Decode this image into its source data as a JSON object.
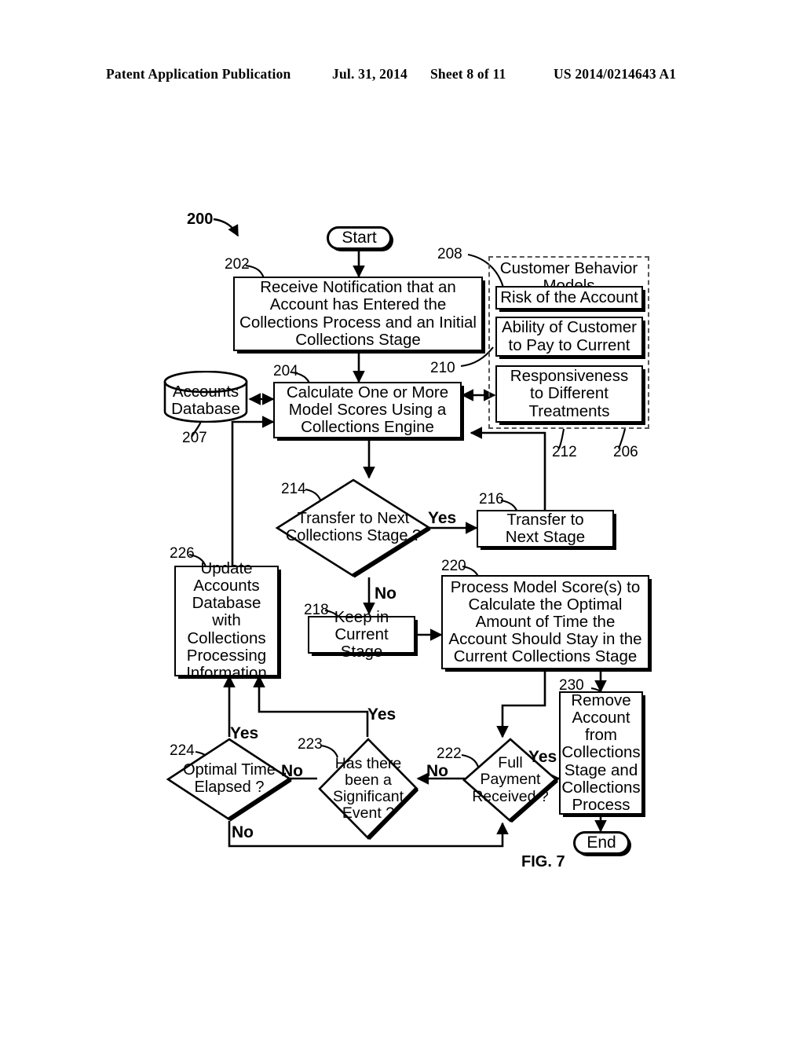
{
  "header": {
    "publication": "Patent Application Publication",
    "date": "Jul. 31, 2014",
    "sheet": "Sheet 8 of 11",
    "doc_number": "US 2014/0214643 A1"
  },
  "figure": {
    "caption": "FIG. 7",
    "diagram_number": "200"
  },
  "nodes": {
    "start": {
      "ref": "",
      "label": "Start"
    },
    "n202": {
      "ref": "202",
      "label": "Receive Notification that an Account has Entered the Collections Process and an Initial Collections Stage"
    },
    "n207": {
      "ref": "207",
      "label": "Accounts Database"
    },
    "n204": {
      "ref": "204",
      "label": "Calculate One or More Model Scores Using a Collections Engine"
    },
    "n206": {
      "ref": "206",
      "label": "Customer Behavior Models"
    },
    "n208": {
      "ref": "208",
      "label": "Risk of the Account"
    },
    "n210": {
      "ref": "210",
      "label": "Ability of Customer to Pay to Current"
    },
    "n212": {
      "ref": "212",
      "label": "Responsiveness to Different Treatments"
    },
    "n214": {
      "ref": "214",
      "label": "Transfer to Next Collections Stage ?"
    },
    "n216": {
      "ref": "216",
      "label": "Transfer to Next Stage"
    },
    "n218": {
      "ref": "218",
      "label": "Keep in Current Stage"
    },
    "n220": {
      "ref": "220",
      "label": "Process Model Score(s) to Calculate the Optimal Amount of Time the Account Should Stay in the Current Collections Stage"
    },
    "n222": {
      "ref": "222",
      "label": "Full Payment Received ?"
    },
    "n223": {
      "ref": "223",
      "label": "Has there been a Significant Event ?"
    },
    "n224": {
      "ref": "224",
      "label": "Optimal Time Elapsed ?"
    },
    "n226": {
      "ref": "226",
      "label": "Update Accounts Database with Collections Processing Information"
    },
    "n230": {
      "ref": "230",
      "label": "Remove Account from Collections Stage and Collections Process"
    },
    "end": {
      "ref": "",
      "label": "End"
    }
  },
  "node_lines": {
    "n202": [
      "Receive Notification that an",
      "Account has Entered the",
      "Collections Process and an Initial",
      "Collections Stage"
    ],
    "n207": [
      "Accounts",
      "Database"
    ],
    "n204": [
      "Calculate One or More",
      "Model Scores Using a",
      "Collections Engine"
    ],
    "n206": [
      "Customer Behavior",
      "Models"
    ],
    "n208": [
      "Risk of the Account"
    ],
    "n210": [
      "Ability of Customer",
      "to Pay to Current"
    ],
    "n212": [
      "Responsiveness",
      "to Different",
      "Treatments"
    ],
    "n214": [
      "Transfer",
      "to Next",
      "Collections Stage",
      "?"
    ],
    "n216": [
      "Transfer to",
      "Next Stage"
    ],
    "n218": [
      "Keep in",
      "Current Stage"
    ],
    "n220": [
      "Process Model Score(s) to",
      "Calculate the Optimal",
      "Amount of Time the",
      "Account Should Stay in the",
      "Current Collections Stage"
    ],
    "n222": [
      "Full",
      "Payment",
      "Received",
      "?"
    ],
    "n223": [
      "Has",
      "there",
      "been a",
      "Significant",
      "Event",
      "?"
    ],
    "n224": [
      "Optimal",
      "Time Elapsed",
      "?"
    ],
    "n226": [
      "Update",
      "Accounts",
      "Database with",
      "Collections",
      "Processing",
      "Information"
    ],
    "n230": [
      "Remove",
      "Account",
      "from",
      "Collections",
      "Stage and",
      "Collections",
      "Process"
    ]
  },
  "branches": {
    "b214_yes": "Yes",
    "b214_no": "No",
    "b224_yes": "Yes",
    "b224_no": "No",
    "b223_yes": "Yes",
    "b223_no": "No",
    "b222_yes": "Yes",
    "b222_no": "No"
  },
  "colors": {
    "ink": "#000000",
    "paper": "#ffffff",
    "dashed": "#555555"
  }
}
